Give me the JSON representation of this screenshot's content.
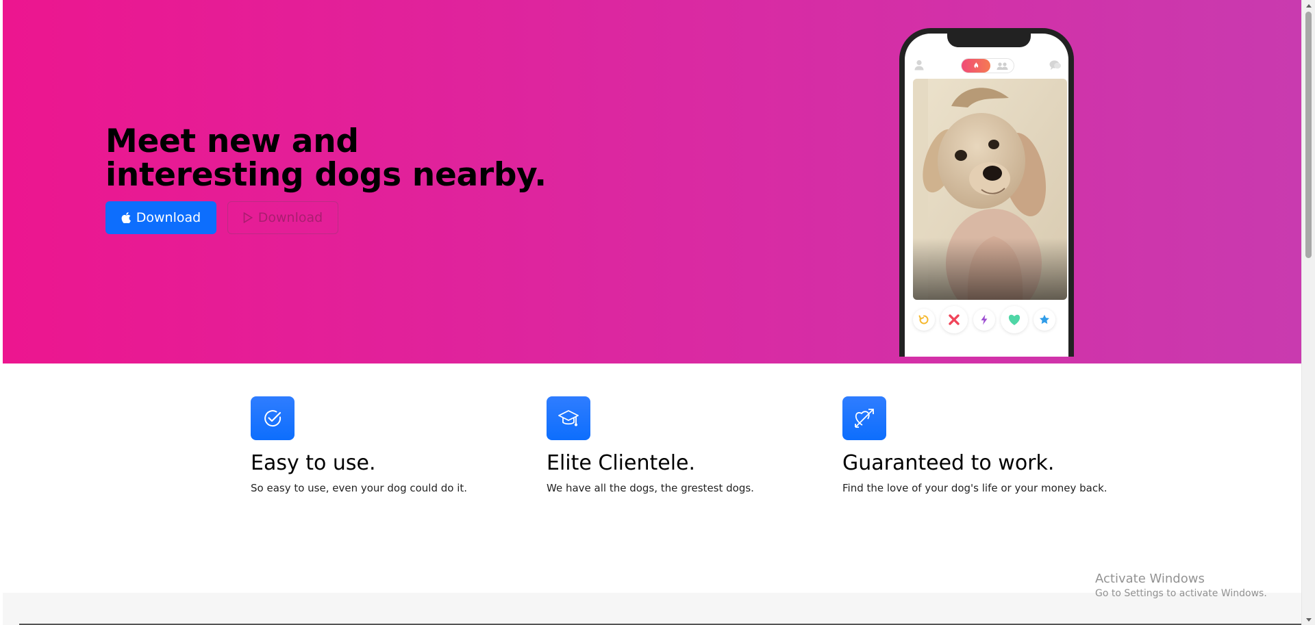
{
  "hero": {
    "headline_line1": "Meet new and",
    "headline_line2": "interesting dogs nearby.",
    "buttons": [
      {
        "label": "Download",
        "icon": "apple-icon",
        "style": "primary"
      },
      {
        "label": "Download",
        "icon": "play-store-icon",
        "style": "outline"
      }
    ],
    "colors": {
      "gradient_start": "#ec168f",
      "gradient_end": "#c93aaf",
      "primary": "#0d6efd"
    }
  },
  "phone": {
    "top_bar_icons": [
      "profile-icon",
      "flame-icon",
      "people-icon",
      "chat-icon"
    ],
    "photo": "dog-photo",
    "actions": [
      "rewind-icon",
      "nope-icon",
      "boost-icon",
      "like-icon",
      "super-like-icon"
    ]
  },
  "features": [
    {
      "icon": "check-circle-icon",
      "title": "Easy to use.",
      "description": "So easy to use, even your dog could do it."
    },
    {
      "icon": "graduation-cap-icon",
      "title": "Elite Clientele.",
      "description": "We have all the dogs, the grestest dogs."
    },
    {
      "icon": "heart-arrow-icon",
      "title": "Guaranteed to work.",
      "description": "Find the love of your dog's life or your money back."
    }
  ],
  "watermark": {
    "title": "Activate Windows",
    "subtitle": "Go to Settings to activate Windows."
  }
}
